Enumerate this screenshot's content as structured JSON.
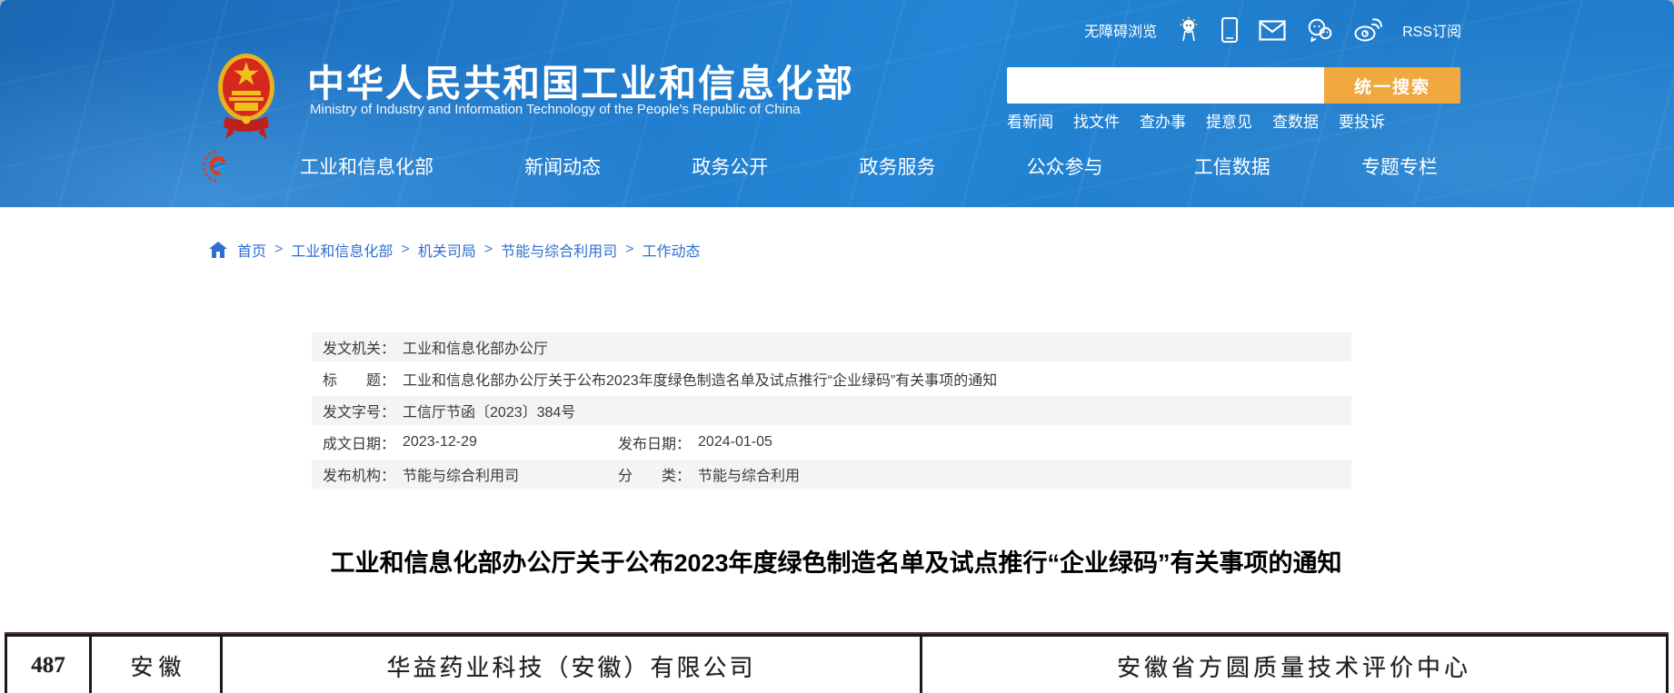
{
  "colors": {
    "header_blue": "#1f7ac9",
    "accent_orange": "#efa93f",
    "link_blue": "#2e6fd0",
    "meta_row_gray": "#f4f4f4"
  },
  "icons": {
    "robot": "robot-assistant-icon",
    "mobile": "mobile-version-icon",
    "mail": "mail-icon",
    "wechat": "wechat-icon",
    "weibo": "weibo-icon",
    "home": "home-icon",
    "emblem": "china-national-emblem",
    "site_logo": "miit-e-logo"
  },
  "header": {
    "site_title": "中华人民共和国工业和信息化部",
    "site_subtitle": "Ministry of Industry and Information Technology of the People's Republic of China",
    "utility": {
      "accessibility_label": "无障碍浏览",
      "rss_label": "RSS订阅"
    },
    "search": {
      "value": "",
      "button_label": "统一搜索"
    },
    "quick_links": [
      "看新闻",
      "找文件",
      "查办事",
      "提意见",
      "查数据",
      "要投诉"
    ],
    "nav": [
      "工业和信息化部",
      "新闻动态",
      "政务公开",
      "政务服务",
      "公众参与",
      "工信数据",
      "专题专栏"
    ]
  },
  "breadcrumb": {
    "separator": ">",
    "items": [
      "首页",
      "工业和信息化部",
      "机关司局",
      "节能与综合利用司",
      "工作动态"
    ]
  },
  "doc_meta": {
    "rows": [
      {
        "label": "发文机关：",
        "value": "工业和信息化部办公厅"
      },
      {
        "label": "标　　题：",
        "value": "工业和信息化部办公厅关于公布2023年度绿色制造名单及试点推行“企业绿码”有关事项的通知"
      },
      {
        "label": "发文字号：",
        "value": "工信厅节函〔2023〕384号"
      },
      {
        "label": "成文日期：",
        "value": "2023-12-29",
        "label2": "发布日期：",
        "value2": "2024-01-05"
      },
      {
        "label": "发布机构：",
        "value": "节能与综合利用司",
        "label2": "分　　类：",
        "value2": "节能与综合利用"
      }
    ]
  },
  "article": {
    "title": "工业和信息化部办公厅关于公布2023年度绿色制造名单及试点推行“企业绿码”有关事项的通知"
  },
  "scan_table": {
    "row": {
      "no": "487",
      "province": "安徽",
      "company": "华益药业科技（安徽）有限公司",
      "agency": "安徽省方圆质量技术评价中心"
    }
  }
}
